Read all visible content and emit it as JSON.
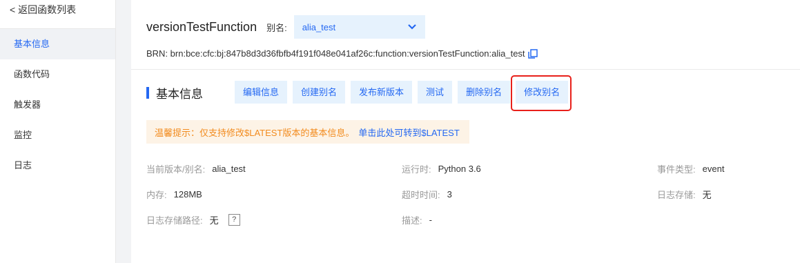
{
  "sidebar": {
    "back_label": "< 返回函数列表",
    "items": [
      {
        "label": "基本信息"
      },
      {
        "label": "函数代码"
      },
      {
        "label": "触发器"
      },
      {
        "label": "监控"
      },
      {
        "label": "日志"
      }
    ]
  },
  "header": {
    "function_name": "versionTestFunction",
    "alias_label": "别名:",
    "alias_value": "alia_test",
    "brn": "BRN:  brn:bce:cfc:bj:847b8d3d36fbfb4f191f048e041af26c:function:versionTestFunction:alia_test"
  },
  "section": {
    "title": "基本信息",
    "buttons": [
      {
        "label": "编辑信息"
      },
      {
        "label": "创建别名"
      },
      {
        "label": "发布新版本"
      },
      {
        "label": "测试"
      },
      {
        "label": "删除别名"
      },
      {
        "label": "修改别名"
      }
    ]
  },
  "notice": {
    "text": "温馨提示：仅支持修改$LATEST版本的基本信息。",
    "link": "单击此处可转到$LATEST"
  },
  "info": {
    "version_alias": {
      "label": "当前版本/别名:",
      "value": "alia_test"
    },
    "runtime": {
      "label": "运行时:",
      "value": "Python 3.6"
    },
    "event_type": {
      "label": "事件类型:",
      "value": "event"
    },
    "memory": {
      "label": "内存:",
      "value": "128MB"
    },
    "timeout": {
      "label": "超时时间:",
      "value": "3"
    },
    "log_storage": {
      "label": "日志存储:",
      "value": "无"
    },
    "log_path": {
      "label": "日志存储路径:",
      "value": "无",
      "help": "?"
    },
    "description": {
      "label": "描述:",
      "value": "-"
    }
  },
  "colors": {
    "accent": "#2468f2",
    "button_bg": "#e6f2fd",
    "notice_bg": "#fdf3e6",
    "notice_text": "#f28b1e",
    "highlight": "#e8201a"
  },
  "active_nav": "基本信息"
}
